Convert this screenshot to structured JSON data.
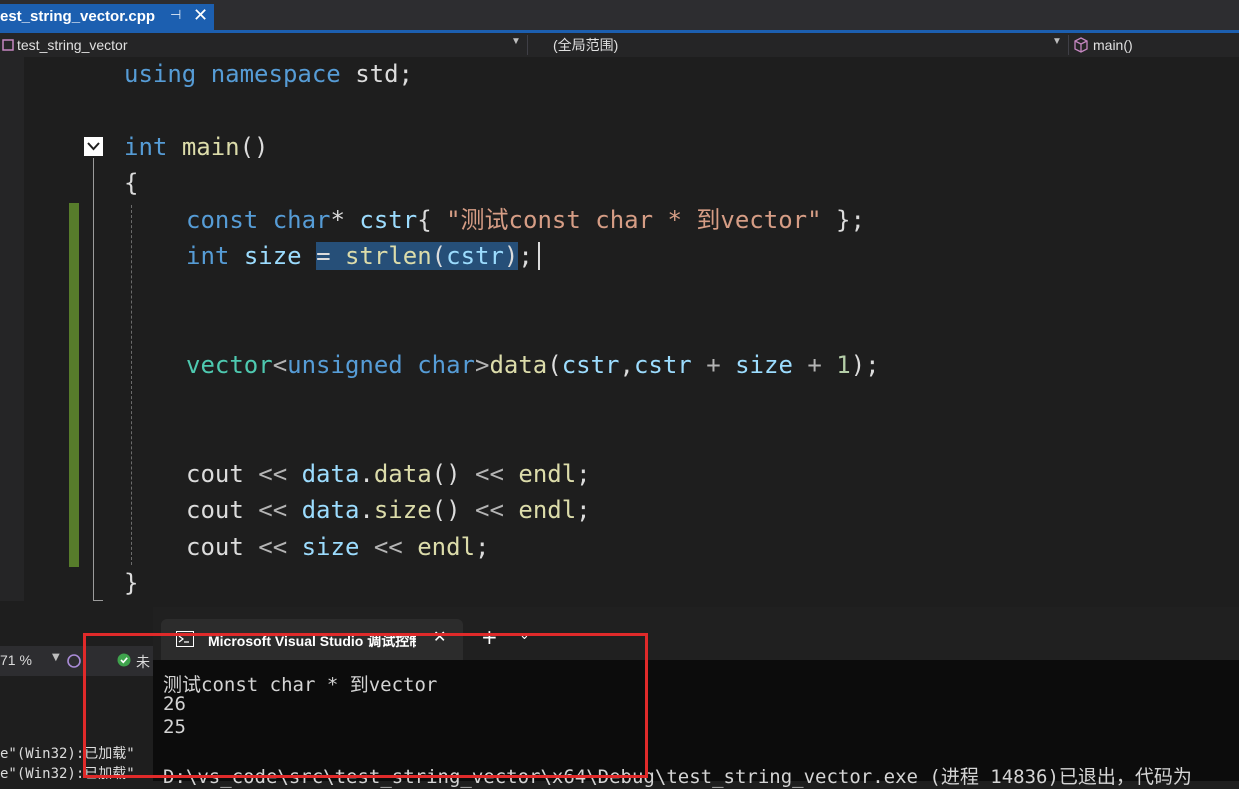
{
  "tab": {
    "filename": "est_string_vector.cpp",
    "pin_glyph": "⊣",
    "close_glyph": "✕"
  },
  "navbar": {
    "project": "test_string_vector",
    "scope": "(全局范围)",
    "member": "main()"
  },
  "code": {
    "line1": [
      "using",
      "namespace",
      "std;"
    ],
    "line_main": [
      "int",
      "main",
      "()"
    ],
    "open_brace": "{",
    "close_brace": "}",
    "decl_cstr": {
      "kw": "const",
      "type": "char",
      "ptr": "*",
      "name": "cstr",
      "open": "{",
      "literal": "\"测试const char * 到vector\"",
      "close": "};"
    },
    "decl_size": {
      "kw": "int",
      "name": "size",
      "eq": "=",
      "fn": "strlen",
      "lp": "(",
      "arg": "cstr",
      "rp": ")",
      "semi": ";"
    },
    "decl_vec": {
      "type": "vector",
      "lt": "<",
      "kw1": "unsigned",
      "kw2": "char",
      "gt": ">",
      "fn": "data",
      "lp": "(",
      "a1": "cstr",
      "comma": ",",
      "a2": "cstr",
      "plus1": "+",
      "a3": "size",
      "plus2": "+",
      "num": "1",
      "end": ");"
    },
    "cout1": {
      "cout": "cout",
      "op1": "<<",
      "obj": "data",
      "dot": ".",
      "fn": "data",
      "call": "()",
      "op2": "<<",
      "endl": "endl",
      "semi": ";"
    },
    "cout2": {
      "cout": "cout",
      "op1": "<<",
      "obj": "data",
      "dot": ".",
      "fn": "size",
      "call": "()",
      "op2": "<<",
      "endl": "endl",
      "semi": ";"
    },
    "cout3": {
      "cout": "cout",
      "op1": "<<",
      "var": "size",
      "op2": "<<",
      "endl": "endl",
      "semi": ";"
    }
  },
  "status": {
    "zoom": "71 %",
    "status_text": "未"
  },
  "output": {
    "line1": "e\"(Win32):已加载\"",
    "line2": "e\"(Win32):已加载\""
  },
  "console": {
    "title": "Microsoft Visual Studio 调试控制台",
    "close_glyph": "✕",
    "plus_glyph": "+",
    "chevron_glyph": "⌄",
    "lines": [
      "测试const char * 到vector",
      "26",
      "25",
      "",
      "D:\\vs_code\\src\\test_string_vector\\x64\\Debug\\test_string_vector.exe (进程 14836)已退出，代码为"
    ]
  },
  "colors": {
    "accent": "#1c5fb0",
    "highlight_border": "#e02a2a",
    "change_bar": "#577c2b"
  }
}
